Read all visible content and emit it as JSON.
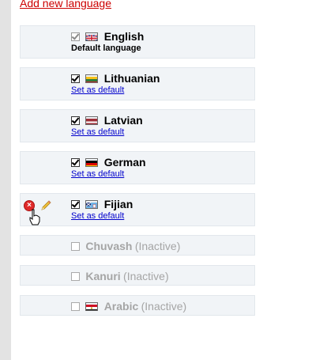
{
  "header": {
    "add_language_label": "Add new language"
  },
  "languages": [
    {
      "name": "English",
      "sub": "Default language",
      "flag": "gb"
    },
    {
      "name": "Lithuanian",
      "sub": "Set as default",
      "flag": "lt"
    },
    {
      "name": "Latvian",
      "sub": "Set as default",
      "flag": "lv"
    },
    {
      "name": "German",
      "sub": "Set as default",
      "flag": "de"
    },
    {
      "name": "Fijian",
      "sub": "Set as default",
      "flag": "fj"
    },
    {
      "name": "Chuvash",
      "status": "(Inactive)",
      "flag": ""
    },
    {
      "name": "Kanuri",
      "status": "(Inactive)",
      "flag": ""
    },
    {
      "name": "Arabic",
      "status": "(Inactive)",
      "flag": "eg"
    }
  ],
  "colors": {
    "link": "#0000cc",
    "add_link": "#cc0000",
    "row_bg": "#f1f4f7",
    "inactive_text": "#a5a5a5"
  },
  "icons": {
    "delete": "delete-icon",
    "edit": "pencil-icon",
    "cursor": "hand-cursor-icon"
  }
}
